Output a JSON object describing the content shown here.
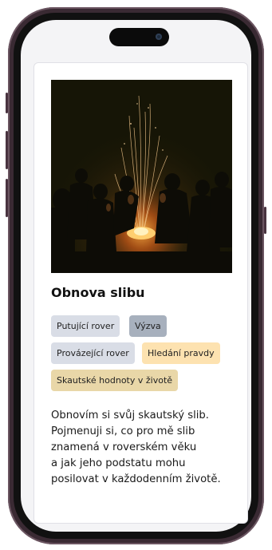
{
  "article": {
    "title": "Obnova slibu",
    "image_alt": "Skauti sedí kolem ohně v noci",
    "tags": [
      {
        "label": "Putující rover",
        "color": "#d9dde6"
      },
      {
        "label": "Výzva",
        "color": "#a7b0bd"
      },
      {
        "label": "Provázející rover",
        "color": "#d9dde6"
      },
      {
        "label": "Hledání pravdy",
        "color": "#fde2b0"
      },
      {
        "label": "Skautské hodnoty v životě",
        "color": "#e9d7a8"
      }
    ],
    "body_lines": [
      "Obnovím si svůj skautský slib.",
      "Pojmenuji si, co pro mě slib",
      "znamená v roverském věku",
      "a jak jeho podstatu mohu",
      "posilovat v každodenním životě."
    ]
  },
  "device": {
    "frame_color": "#3a2a33",
    "screen_color": "#f4f4f6"
  }
}
